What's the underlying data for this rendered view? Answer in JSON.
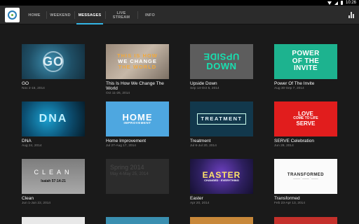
{
  "status_bar": {
    "time": "10:26"
  },
  "app": {
    "logo": "church-logo"
  },
  "tabs": [
    {
      "label": "HOME",
      "active": false
    },
    {
      "label": "WEEKEND",
      "active": false
    },
    {
      "label": "MESSAGES",
      "active": true
    },
    {
      "label_line1": "LIVE",
      "label_line2": "STREAM",
      "active": false
    },
    {
      "label": "INFO",
      "active": false
    }
  ],
  "colors": {
    "accent": "#33b5e5",
    "app_bar": "#2b2b2b",
    "background": "#1a1a1a"
  },
  "messages": [
    {
      "title": "GO",
      "date": "Nov 2-16, 2014",
      "thumb": {
        "text": "GO"
      }
    },
    {
      "title": "This Is How We Change The World",
      "date": "Oct 11-26, 2014",
      "thumb": {
        "line1": "THIS IS HOW",
        "line2": "WE CHANGE",
        "line3": "THE WORLD"
      }
    },
    {
      "title": "Upside Down",
      "date": "Sep 14-Oct 5, 2014",
      "thumb": {
        "line1": "UPSIDE",
        "line2": "DOWN"
      }
    },
    {
      "title": "Power Of The Invite",
      "date": "Aug 30-Sep 7, 2014",
      "thumb": {
        "line1": "POWER",
        "line2": "OF THE",
        "line3": "INVITE"
      }
    },
    {
      "title": "DNA",
      "date": "Aug 24, 2014",
      "thumb": {
        "text": "DNA"
      }
    },
    {
      "title": "Home Improvement",
      "date": "Jul 27-Aug 17, 2014",
      "thumb": {
        "big": "HOME",
        "small": "IMPROVEMENT"
      }
    },
    {
      "title": "Treatment",
      "date": "Jul 6-Jul 20, 2014",
      "thumb": {
        "text": "TREATMENT"
      }
    },
    {
      "title": "SERVE Celebration",
      "date": "Jun 29, 2014",
      "thumb": {
        "line1": "LOVE",
        "line2": "COME TO LIFE",
        "line3": "SERVE"
      }
    },
    {
      "title": "Clean",
      "date": "Jun 1-Jun 22, 2014",
      "thumb": {
        "big": "CLEAN",
        "small": "Isaiah 57:14-21"
      }
    },
    {
      "title": "",
      "date": "",
      "thumb": {
        "big": "Spring 2014",
        "small": "May 4-May 25, 2014"
      }
    },
    {
      "title": "Easter",
      "date": "Apr 20, 2014",
      "thumb": {
        "big": "EASTER",
        "small": "CHANGED · EVERYTHING"
      }
    },
    {
      "title": "Transformed",
      "date": "Feb 23-Apr 13, 2014",
      "thumb": {
        "big": "TRANSFORMED",
        "small": "_____ · _____ · _____"
      }
    }
  ]
}
